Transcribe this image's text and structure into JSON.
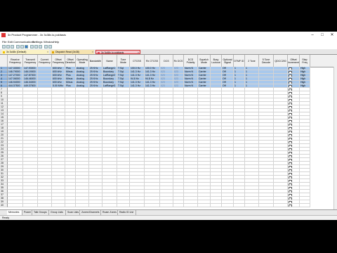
{
  "window": {
    "title": "3x Product Programmer - 3x 3c38x.lo.pokitasis"
  },
  "menu": [
    "File",
    "Edit",
    "Communications",
    "Settings",
    "Window",
    "Help"
  ],
  "doc_tabs": [
    {
      "label": "3x 3c48x (Default)",
      "color": "#f2c200",
      "active": false
    },
    {
      "label": "Dispatch Read (3x38)",
      "color": "#e0a500",
      "active": false
    },
    {
      "label": "3x 3c48x.lo.pokitaxis",
      "color": "#d9475c",
      "active": true
    }
  ],
  "columns": [
    "Receive Frequency",
    "Transmit Frequency",
    "Current Frequency",
    "Offset Frequency",
    "Offset Direction",
    "Operating Mode",
    "Bandwidth",
    "Name",
    "Tone Mode",
    "CTCSS",
    "Rx CTCSS",
    "DCS",
    "Rx DCS",
    "DCS Polarity",
    "Squelch Mode",
    "Busy Lockout",
    "Optional Signal",
    "DTMF ID",
    "2 Tone",
    "5 Tone Decode",
    "QDCC200",
    "Offset Increment",
    "Step Freq"
  ],
  "rows": [
    [
      "147.33000",
      "147.93000",
      "",
      "600 kHz",
      "Plus",
      "Analog",
      "25 KHz",
      "LatRange1",
      "T Sql",
      "100.0 Hz",
      "100.0 Hz",
      "023",
      "023",
      "Norm N",
      "Carrier",
      "",
      "Off",
      "1",
      "1",
      "",
      "",
      "",
      "High"
    ],
    [
      "146.79000",
      "146.19000",
      "",
      "600 kHz",
      "Minus",
      "Analog",
      "25 KHz",
      "Boundary",
      "T Sql",
      "141.3 Hz",
      "141.3 Hz",
      "023",
      "023",
      "Norm N",
      "Carrier",
      "",
      "Off",
      "1",
      "1",
      "",
      "",
      "",
      "High"
    ],
    [
      "147.27000",
      "147.87000",
      "",
      "600 kHz",
      "Plus",
      "Analog",
      "25 KHz",
      "LatRange2",
      "T Sql",
      "141.3 Hz",
      "141.3 Hz",
      "023",
      "023",
      "Norm N",
      "Carrier",
      "",
      "Off",
      "1",
      "1",
      "",
      "",
      "",
      "High"
    ],
    [
      "147.06000",
      "146.46000",
      "",
      "600 kHz",
      "Minus",
      "Analog",
      "25 KHz",
      "Boundary",
      "T Sql",
      "94.8 Hz",
      "94.8 Hz",
      "023",
      "023",
      "Norm N",
      "Carrier",
      "",
      "Off",
      "1",
      "1",
      "",
      "",
      "",
      "High"
    ],
    [
      "146.94000",
      "146.34000",
      "",
      "600 kHz",
      "Minus",
      "Analog",
      "25 KHz",
      "Boundary",
      "T Sql",
      "141.3 Hz",
      "141.3 Hz",
      "023",
      "023",
      "Norm N",
      "Carrier",
      "",
      "Off",
      "1",
      "1",
      "",
      "",
      "",
      "High"
    ],
    [
      "444.37500",
      "449.37500",
      "",
      "5.00 MHz",
      "Plus",
      "Analog",
      "25 KHz",
      "LatRange3",
      "T Sql",
      "141.3 Hz",
      "141.3 Hz",
      "023",
      "023",
      "Norm N",
      "Carrier",
      "",
      "Off",
      "1",
      "1",
      "",
      "",
      "",
      "High"
    ]
  ],
  "sheet_tabs": [
    "Memories",
    "Power",
    "Talk Groups",
    "Group Lists",
    "Scan Lists",
    "Zones/Channels",
    "Roam Zones",
    "Radio ID List"
  ],
  "status": "Ready",
  "colors": {
    "selection": "#a8c8ec",
    "header": "#f0f0f0"
  }
}
